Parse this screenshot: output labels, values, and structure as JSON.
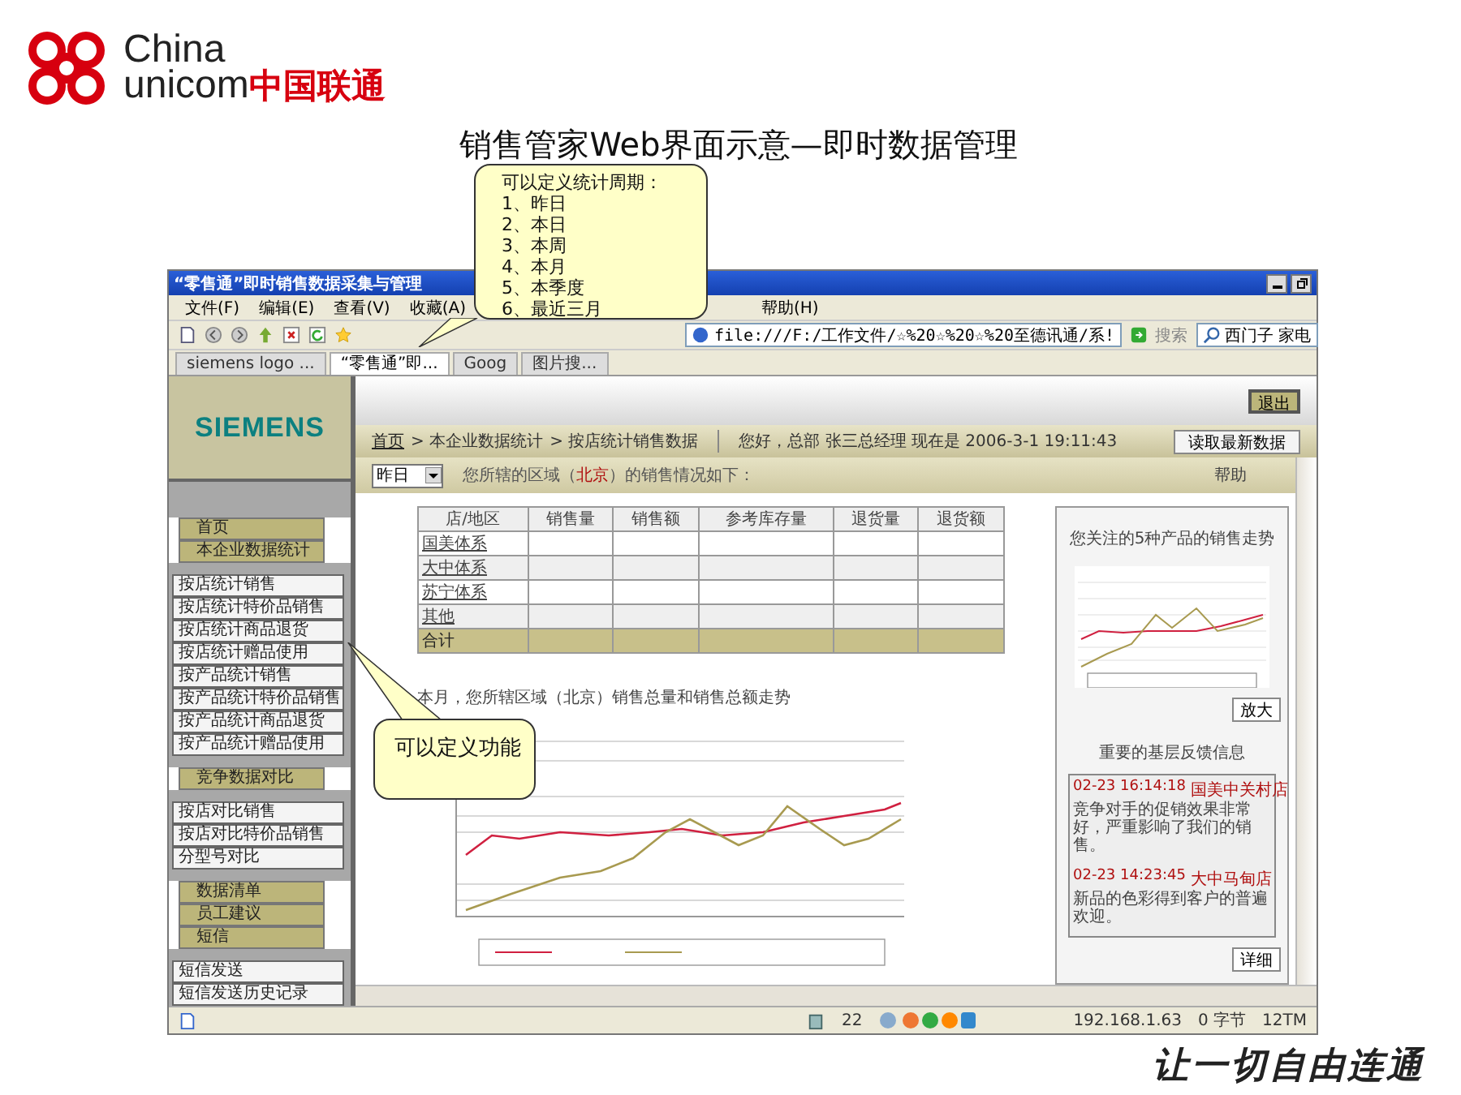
{
  "logo": {
    "latin": [
      "China",
      "unicom"
    ],
    "cn": "中国联通"
  },
  "slide_title": "销售管家Web界面示意—即时数据管理",
  "callouts": [
    {
      "lines": [
        "可以定义统计周期：",
        "1、昨日",
        "2、本日",
        "3、本周",
        "4、本月",
        "5、本季度",
        "6、最近三月"
      ]
    },
    {
      "lines": [
        "可以定义功能"
      ]
    }
  ],
  "browser": {
    "title": "“零售通”即时销售数据采集与管理",
    "menu": [
      "文件(F)",
      "编辑(E)",
      "查看(V)",
      "收藏(A)",
      "帮助(H)"
    ],
    "address": "file:///F:/工作文件/☆%20☆%20☆%20至德讯通/系!",
    "search_label": "搜索",
    "search_value": "西门子 家电",
    "tabs": [
      {
        "label": "siemens logo ...",
        "selected": false
      },
      {
        "label": "“零售通”即...",
        "selected": true
      },
      {
        "label": "Goog",
        "selected": false
      },
      {
        "label": "图片搜...",
        "selected": false
      }
    ],
    "status": {
      "count": "22",
      "ip": "192.168.1.63",
      "bytes": "0 字节",
      "speed": "12TM"
    }
  },
  "app": {
    "brand": "SIEMENS",
    "logout": "退出",
    "breadcrumb": [
      {
        "label": "首页",
        "kind": "link"
      },
      {
        "label": "> 本企业数据统计",
        "kind": "text"
      },
      {
        "label": "> 按店统计销售数据",
        "kind": "text"
      }
    ],
    "greeting": "您好，总部 张三总经理 现在是 2006-3-1 19:11:43",
    "refresh": "读取最新数据",
    "period": "昨日",
    "region_note": "您所辖的区域（**北京**）的销售情况如下：",
    "help": "帮助",
    "sidebar": [
      {
        "kind": "main",
        "items": [
          "首页",
          "本企业数据统计"
        ]
      },
      {
        "kind": "sub",
        "items": [
          "按店统计销售",
          "按店统计特价品销售",
          "按店统计商品退货",
          "按店统计赠品使用",
          "按产品统计销售",
          "按产品统计特价品销售",
          "按产品统计商品退货",
          "按产品统计赠品使用"
        ]
      },
      {
        "kind": "main",
        "items": [
          "竞争数据对比"
        ]
      },
      {
        "kind": "sub",
        "items": [
          "按店对比销售",
          "按店对比特价品销售",
          "分型号对比"
        ]
      },
      {
        "kind": "main",
        "items": [
          "数据清单",
          "员工建议",
          "短信"
        ]
      },
      {
        "kind": "sub",
        "items": [
          "短信发送",
          "短信发送历史记录"
        ]
      }
    ],
    "table": {
      "columns": [
        "店/地区",
        "销售量",
        "销售额",
        "参考库存量",
        "退货量",
        "退货额"
      ],
      "rows": [
        {
          "name": "国美体系",
          "kind": "link"
        },
        {
          "name": "大中体系",
          "kind": "link"
        },
        {
          "name": "苏宁体系",
          "kind": "link"
        },
        {
          "name": "其他",
          "kind": "link"
        },
        {
          "name": "合计",
          "kind": "total"
        }
      ]
    },
    "chart_caption": "本月，您所辖区域（北京）销售总量和销售总额走势",
    "side_panel": {
      "title": "您关注的5种产品的销售走势",
      "zoom": "放大",
      "feedback_title": "重要的基层反馈信息",
      "feedback": [
        {
          "time": "02-23 16:14:18",
          "store": "国美中关村店",
          "text": "竞争对手的促销效果非常好，严重影响了我们的销售。"
        },
        {
          "time": "02-23 14:23:45",
          "store": "大中马甸店",
          "text": "新品的色彩得到客户的普遍欢迎。"
        }
      ],
      "detail": "详细"
    }
  },
  "slogan": "让一切自由连通"
}
